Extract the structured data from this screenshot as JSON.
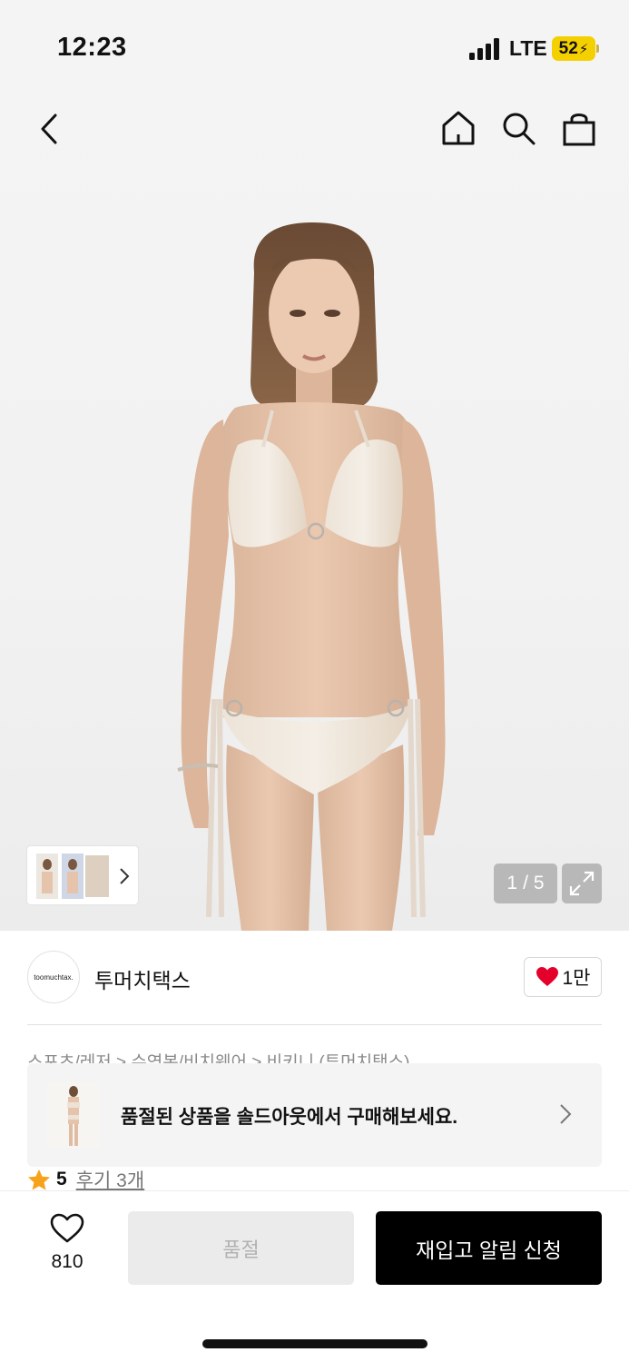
{
  "status_bar": {
    "time": "12:23",
    "network": "LTE",
    "battery": "52"
  },
  "gallery": {
    "current_page": "1",
    "separator": "/",
    "total_pages": "5"
  },
  "brand": {
    "logo_text": "toomuchtax.",
    "name": "투머치택스",
    "like_count": "1만"
  },
  "breadcrumb": {
    "text": "스포츠/레저 > 수영복/비치웨어 > 비키니 (투머치택스)"
  },
  "soldout_banner": {
    "text": "품절된 상품을 솔드아웃에서 구매해보세요."
  },
  "rating": {
    "score": "5",
    "review_label": "후기 3개"
  },
  "bottom_bar": {
    "wish_count": "810",
    "soldout_label": "품절",
    "restock_label": "재입고 알림 신청"
  },
  "colors": {
    "heart": "#e4002b",
    "star": "#f7a21b",
    "battery": "#f5d000",
    "primary_button": "#000000",
    "disabled_button": "#ebebeb"
  },
  "icons": [
    "back-arrow-icon",
    "home-icon",
    "search-icon",
    "shopping-bag-icon",
    "chevron-right-icon",
    "expand-icon",
    "heart-icon",
    "star-icon"
  ]
}
